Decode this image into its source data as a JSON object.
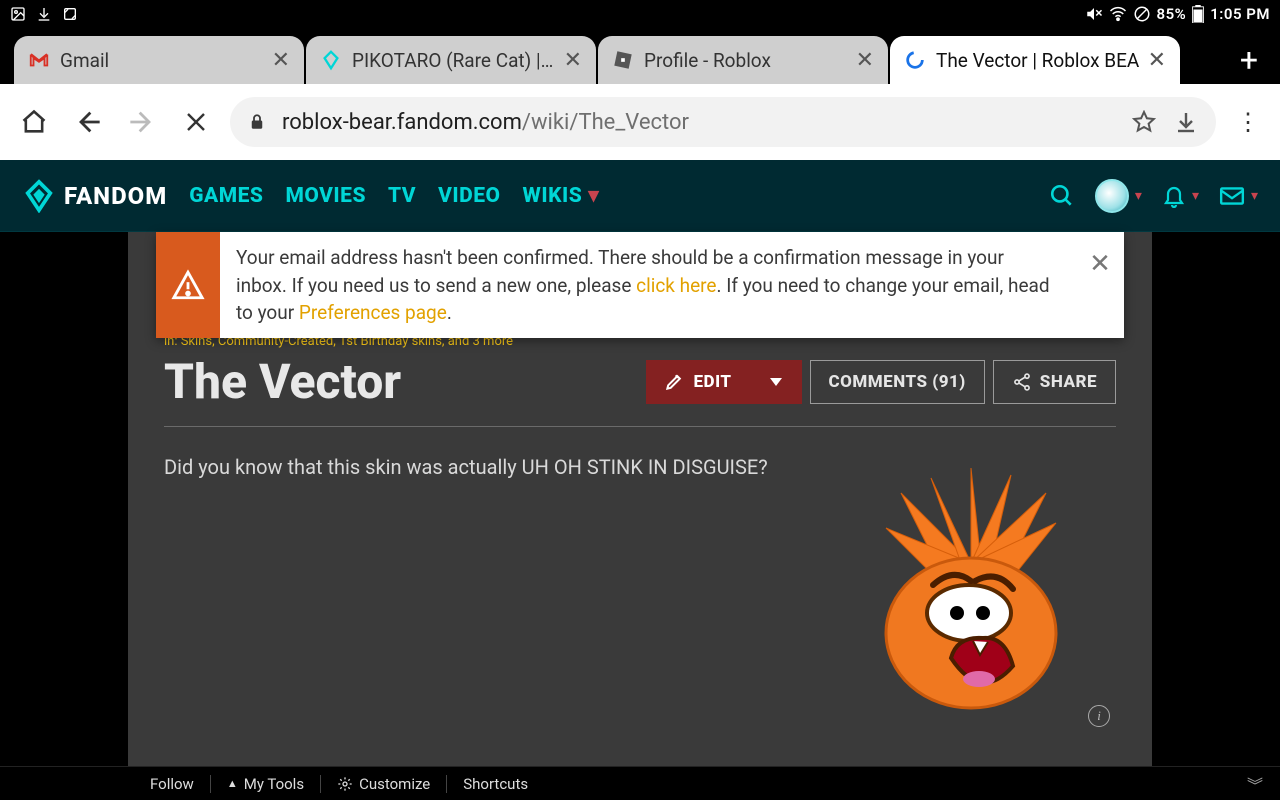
{
  "status_bar": {
    "battery": "85%",
    "time": "1:05 PM"
  },
  "tabs": [
    {
      "title": "Gmail"
    },
    {
      "title": "PIKOTARO (Rare Cat) | B"
    },
    {
      "title": "Profile - Roblox"
    },
    {
      "title": "The Vector | Roblox BEA"
    }
  ],
  "tab_add": "+",
  "url": {
    "host": "roblox-bear.fandom.com",
    "path": "/wiki/The_Vector"
  },
  "fandom": {
    "brand": "FANDOM",
    "nav": [
      "GAMES",
      "MOVIES",
      "TV",
      "VIDEO",
      "WIKIS"
    ]
  },
  "notif": {
    "line1": "Your email address hasn't been confirmed. There should be a confirmation message in your inbox. If you need us to send a new one, please ",
    "link1": "click here",
    "mid": ". If you need to change your email, head to your ",
    "link2": "Preferences page",
    "end": "."
  },
  "categories": "in: Skins, Community-Created, 1st Birthday skins, and 3 more",
  "page": {
    "title": "The Vector",
    "edit": "EDIT",
    "comments": "COMMENTS (91)",
    "share": "SHARE",
    "body": "Did you know that this skin was actually UH OH STINK IN DISGUISE?"
  },
  "admin": {
    "follow": "Follow",
    "mytools": "My Tools",
    "customize": "Customize",
    "shortcuts": "Shortcuts"
  }
}
